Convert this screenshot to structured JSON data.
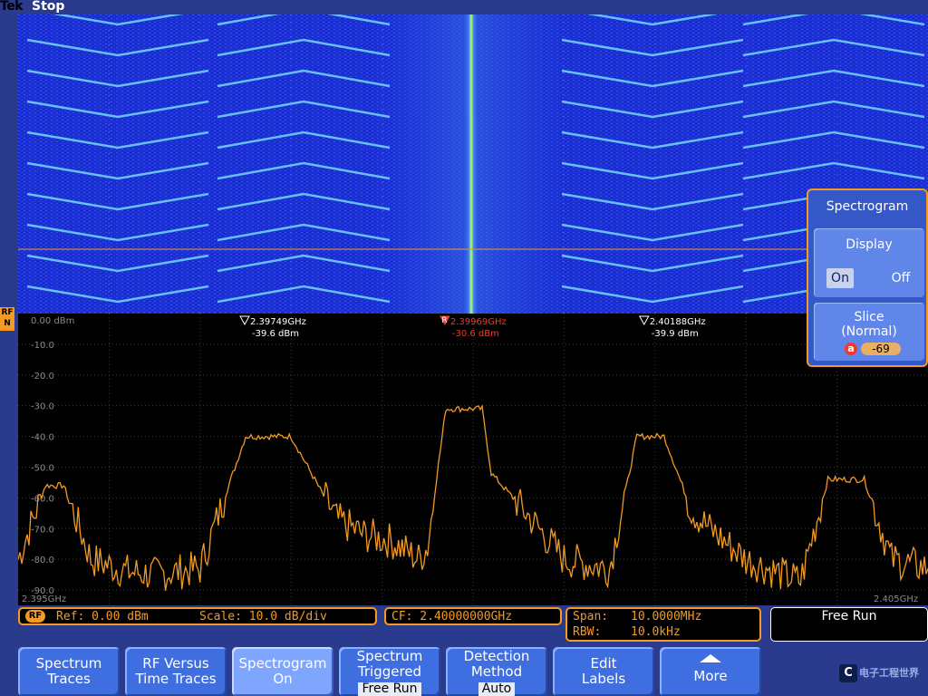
{
  "status": {
    "brand": "Tek",
    "run_state": "Stop"
  },
  "rf_marker": {
    "line1": "RF",
    "line2": "N"
  },
  "spectrum_plot": {
    "ref_level_label": "0.00 dBm",
    "y_ticks": [
      "-10.0",
      "-20.0",
      "-30.0",
      "-40.0",
      "-50.0",
      "-60.0",
      "-70.0",
      "-80.0",
      "-90.0"
    ],
    "x_start_label": "2.395GHz",
    "x_end_label": "2.405GHz",
    "markers": [
      {
        "type": "delta",
        "freq": "2.39749GHz",
        "level": "-39.6 dBm"
      },
      {
        "type": "reference",
        "glyph": "R",
        "freq": "2.39969GHz",
        "level": "-30.6 dBm"
      },
      {
        "type": "delta",
        "freq": "2.40188GHz",
        "level": "-39.9 dBm"
      }
    ]
  },
  "chart_data": {
    "type": "line",
    "title": "",
    "xlabel": "",
    "ylabel": "",
    "xlim": [
      2.395,
      2.405
    ],
    "ylim": [
      -95,
      0
    ],
    "y_unit": "dBm",
    "x_unit": "GHz",
    "series": [
      {
        "x": [
          2.395,
          2.3953,
          2.3955,
          2.3958,
          2.3962,
          2.3965,
          2.397,
          2.3975,
          2.398,
          2.3985,
          2.3988,
          2.3991,
          2.3994,
          2.3995,
          2.3997,
          2.3999,
          2.4001,
          2.4002,
          2.4005,
          2.401,
          2.4015,
          2.4018,
          2.4021,
          2.4024,
          2.4026,
          2.403,
          2.4034,
          2.4036,
          2.4039,
          2.404,
          2.4043,
          2.4046,
          2.405
        ],
        "y": [
          -80,
          -56,
          -56,
          -80,
          -84,
          -85,
          -83,
          -40,
          -40,
          -67,
          -72,
          -74,
          -80,
          -76,
          -31,
          -31,
          -31,
          -52,
          -62,
          -80,
          -83,
          -40,
          -40,
          -64,
          -70,
          -80,
          -85,
          -87,
          -54,
          -54,
          -54,
          -80,
          -83
        ]
      }
    ]
  },
  "side_menu": {
    "title": "Spectrogram",
    "display": {
      "label": "Display",
      "on": "On",
      "off": "Off"
    },
    "slice": {
      "line1": "Slice",
      "line2": "(Normal)",
      "knob": "a",
      "value": "-69"
    }
  },
  "readouts": {
    "rf_badge": "RF",
    "ref": "Ref: 0.00 dBm",
    "scale": "Scale: 10.0 dB/div",
    "cf": "CF:  2.40000000GHz",
    "span_label": "Span:",
    "span_value": "10.0000MHz",
    "rbw_label": "RBW:",
    "rbw_value": "10.0kHz",
    "trigger_mode": "Free Run"
  },
  "softkeys": [
    {
      "line1": "Spectrum",
      "line2": "Traces"
    },
    {
      "line1": "RF Versus",
      "line2": "Time Traces"
    },
    {
      "line1": "Spectrogram",
      "line2": "On"
    },
    {
      "line1": "Spectrum",
      "line2": "Triggered",
      "value": "Free Run"
    },
    {
      "line1": "Detection",
      "line2": "Method",
      "value": "Auto"
    },
    {
      "line1": "Edit",
      "line2": "Labels"
    },
    {
      "line1": "More"
    }
  ],
  "watermark": {
    "glyph": "C",
    "text": "电子工程世界"
  },
  "colors": {
    "bezel": "#2a3a8c",
    "accent": "#f39a22",
    "trace": "#f39a22",
    "reference_marker": "#f03a2a",
    "spectrogram_bg": "#1a2ad8",
    "button": "#3f6ee0"
  }
}
